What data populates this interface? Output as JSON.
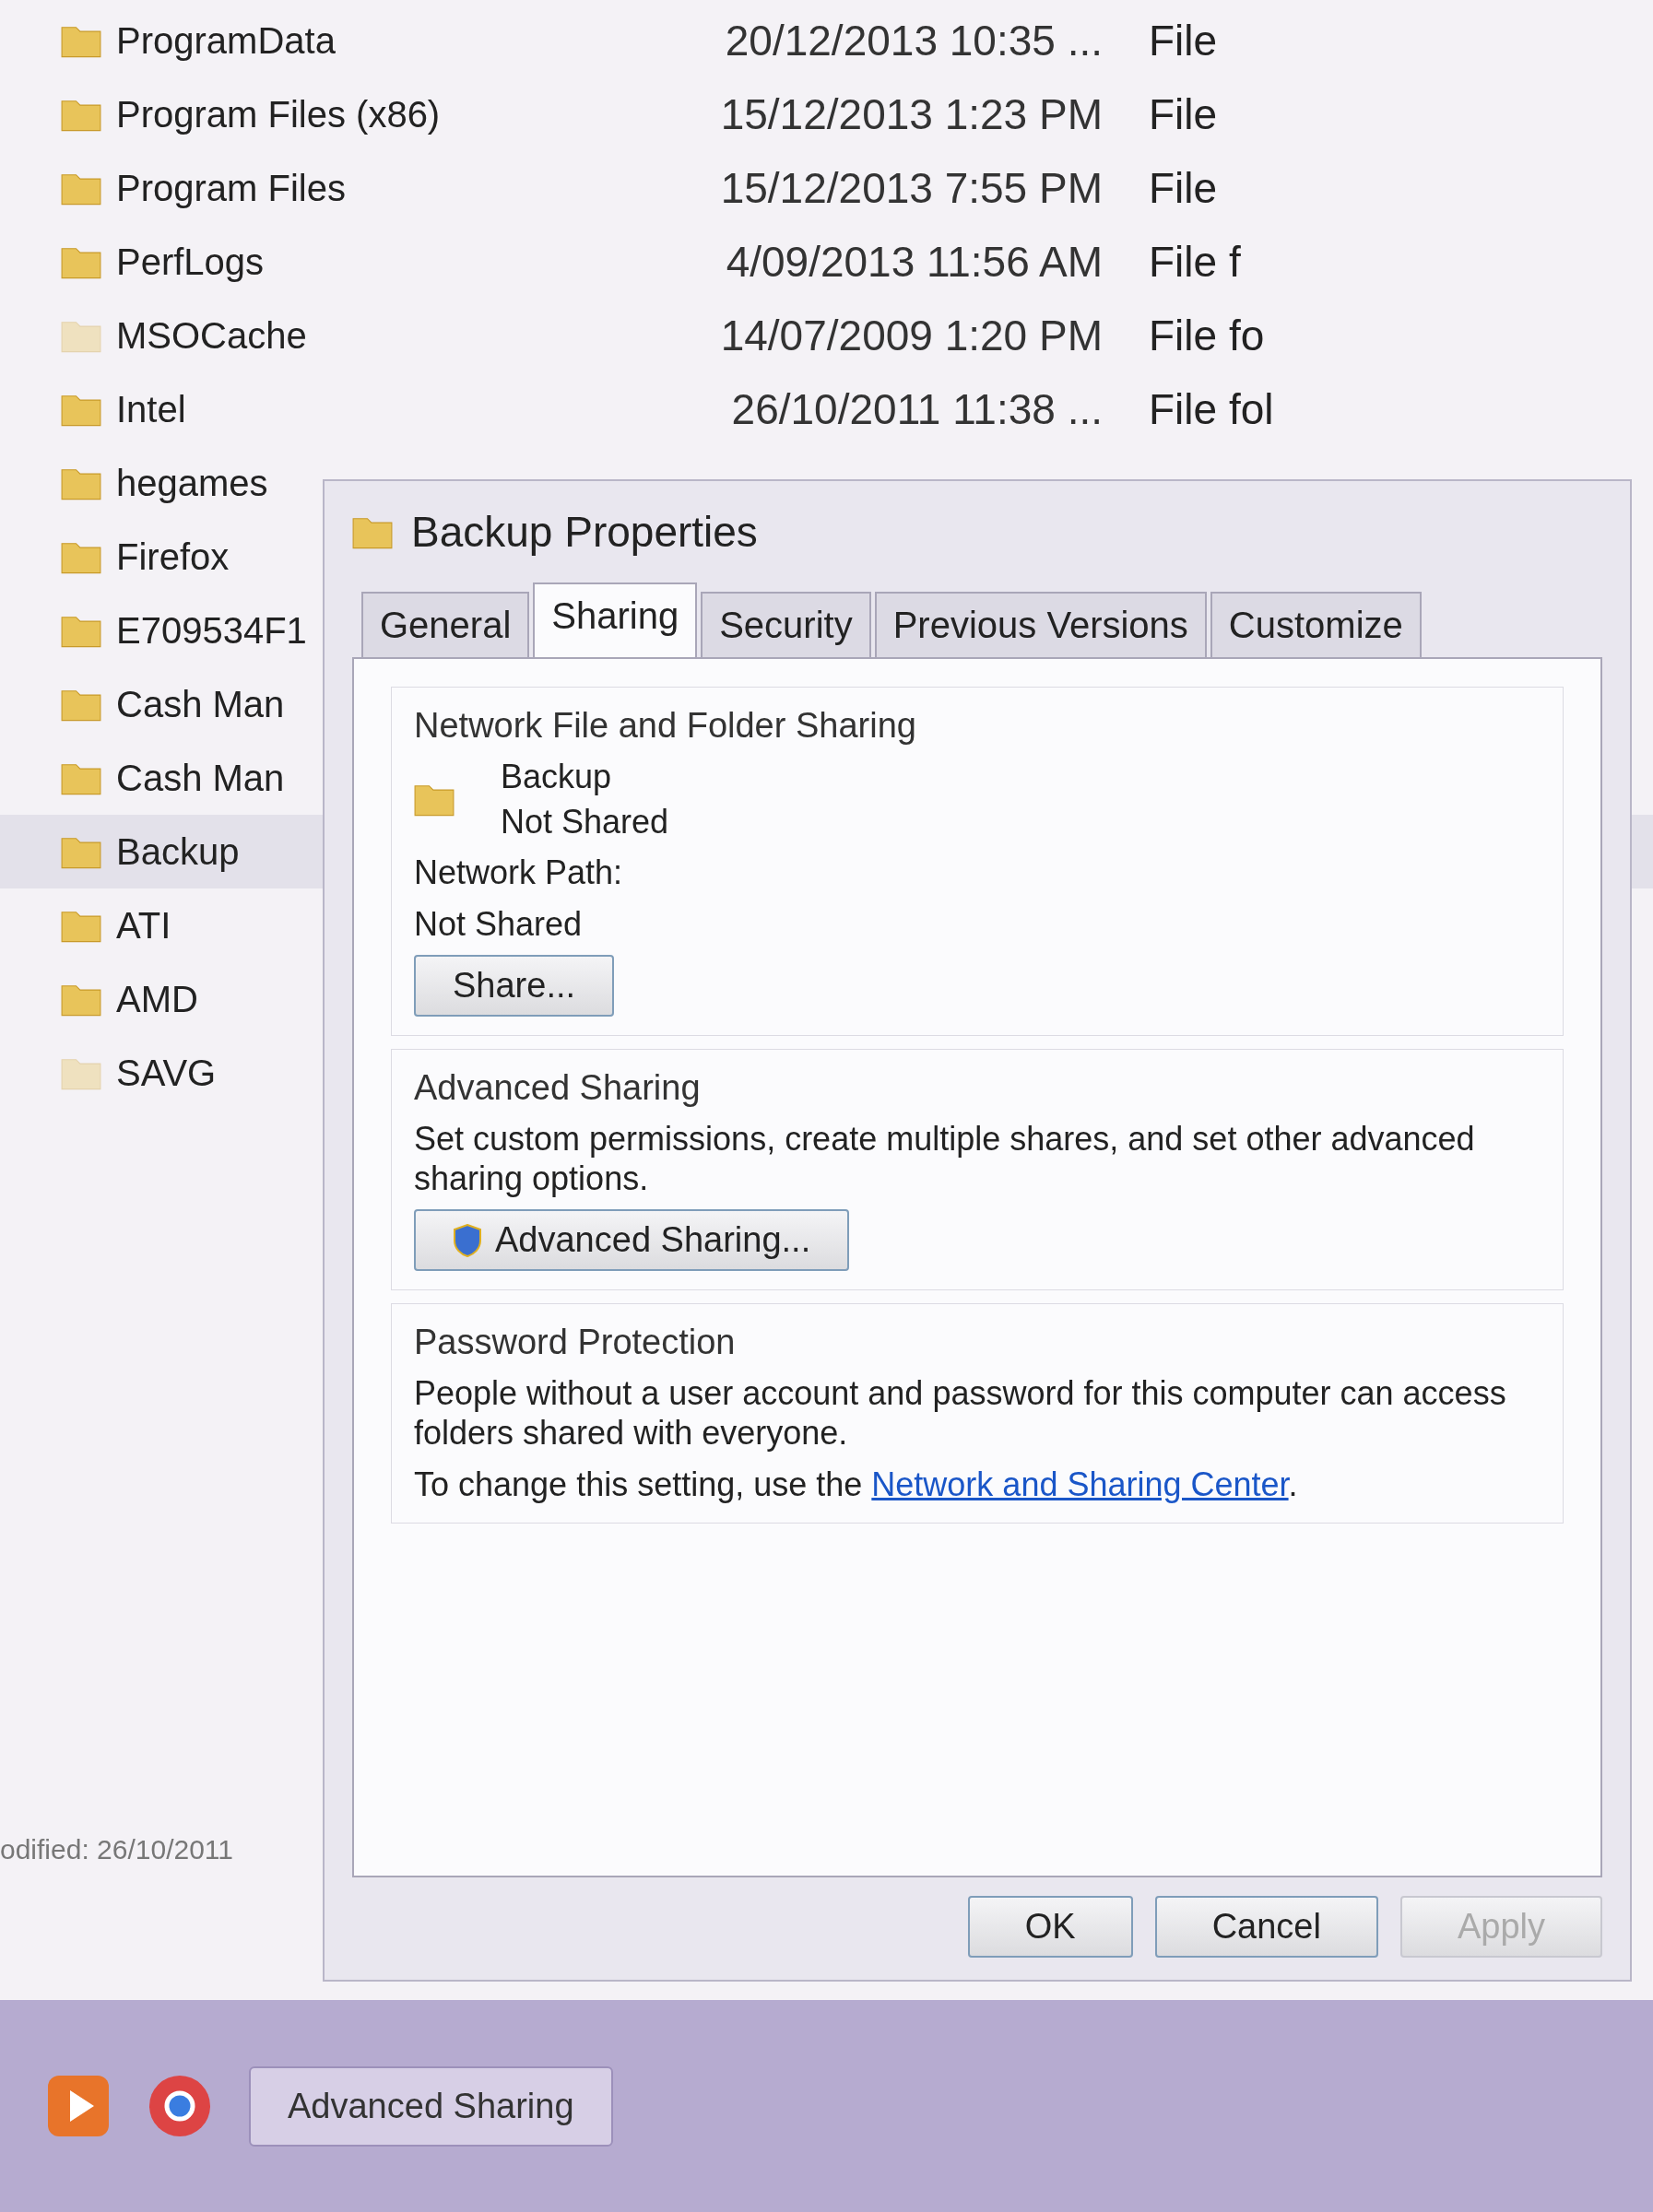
{
  "explorer": {
    "rows": [
      {
        "name": "ProgramData",
        "date": "20/12/2013 10:35 ...",
        "type": "File",
        "selected": false,
        "hidden": false
      },
      {
        "name": "Program Files (x86)",
        "date": "15/12/2013 1:23 PM",
        "type": "File",
        "selected": false,
        "hidden": false
      },
      {
        "name": "Program Files",
        "date": "15/12/2013 7:55 PM",
        "type": "File",
        "selected": false,
        "hidden": false
      },
      {
        "name": "PerfLogs",
        "date": "4/09/2013 11:56 AM",
        "type": "File f",
        "selected": false,
        "hidden": false
      },
      {
        "name": "MSOCache",
        "date": "14/07/2009 1:20 PM",
        "type": "File fo",
        "selected": false,
        "hidden": true
      },
      {
        "name": "Intel",
        "date": "26/10/2011 11:38 ...",
        "type": "File fol",
        "selected": false,
        "hidden": false
      },
      {
        "name": "hegames",
        "selected": false,
        "hidden": false
      },
      {
        "name": "Firefox",
        "selected": false,
        "hidden": false
      },
      {
        "name": "E709534F1",
        "selected": false,
        "hidden": false
      },
      {
        "name": "Cash Man",
        "selected": false,
        "hidden": false
      },
      {
        "name": "Cash Man",
        "selected": false,
        "hidden": false
      },
      {
        "name": "Backup",
        "selected": true,
        "hidden": false
      },
      {
        "name": "ATI",
        "selected": false,
        "hidden": false
      },
      {
        "name": "AMD",
        "selected": false,
        "hidden": false
      },
      {
        "name": "SAVG",
        "selected": false,
        "hidden": true
      }
    ]
  },
  "status_text": "odified: 26/10/2011",
  "dialog": {
    "title": "Backup Properties",
    "tabs": [
      {
        "label": "General",
        "selected": false
      },
      {
        "label": "Sharing",
        "selected": true
      },
      {
        "label": "Security",
        "selected": false
      },
      {
        "label": "Previous Versions",
        "selected": false
      },
      {
        "label": "Customize",
        "selected": false
      }
    ],
    "network_sharing": {
      "heading": "Network File and Folder Sharing",
      "folder_name": "Backup",
      "folder_status": "Not Shared",
      "path_label": "Network Path:",
      "path_value": "Not Shared",
      "share_button": "Share..."
    },
    "advanced_sharing": {
      "heading": "Advanced Sharing",
      "description": "Set custom permissions, create multiple shares, and set other advanced sharing options.",
      "button": "Advanced Sharing..."
    },
    "password_protection": {
      "heading": "Password Protection",
      "description": "People without a user account and password for this computer can access folders shared with everyone.",
      "change_prefix": "To change this setting, use the ",
      "link": "Network and Sharing Center",
      "change_suffix": "."
    },
    "buttons": [
      {
        "label": "OK",
        "disabled": false
      },
      {
        "label": "Cancel",
        "disabled": false
      },
      {
        "label": "Apply",
        "disabled": true
      }
    ]
  },
  "taskbar": {
    "window_button": "Advanced Sharing"
  }
}
